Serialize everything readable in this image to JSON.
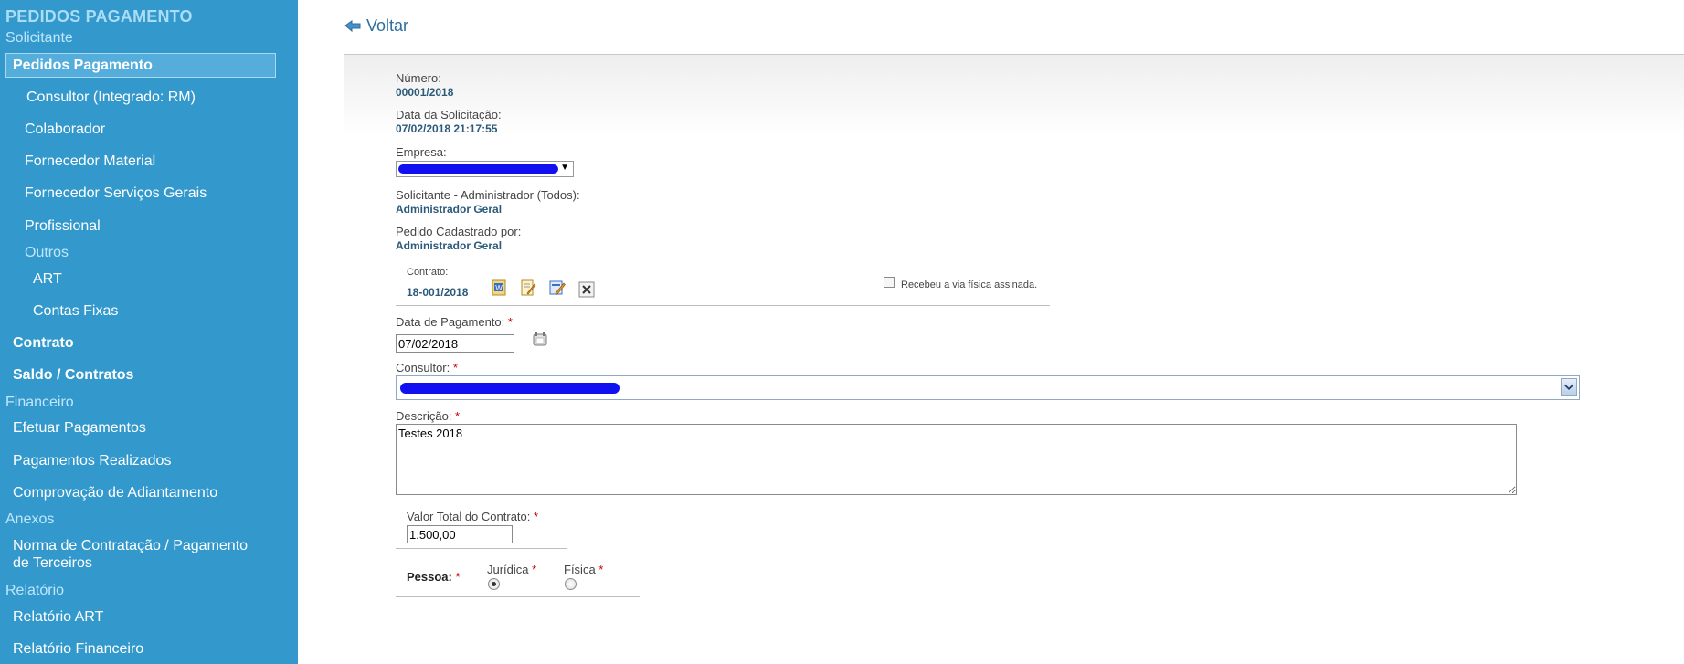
{
  "sidebar": {
    "title": "PEDIDOS PAGAMENTO",
    "sections": {
      "solicitante": "Solicitante",
      "outros": "Outros",
      "financeiro": "Financeiro",
      "anexos": "Anexos",
      "relatorio": "Relatório"
    },
    "items": {
      "pedidos": "Pedidos Pagamento",
      "consultor": "Consultor (Integrado: RM)",
      "colaborador": "Colaborador",
      "fornecedor_material": "Fornecedor Material",
      "fornecedor_servicos": "Fornecedor Serviços Gerais",
      "profissional": "Profissional",
      "art": "ART",
      "contas_fixas": "Contas Fixas",
      "contrato": "Contrato",
      "saldo_contratos": "Saldo / Contratos",
      "efetuar": "Efetuar Pagamentos",
      "realizados": "Pagamentos Realizados",
      "comprovacao": "Comprovação de Adiantamento",
      "norma_line1": "Norma de Contratação / Pagamento",
      "norma_line2": "de Terceiros",
      "rel_art": "Relatório ART",
      "rel_financeiro": "Relatório Financeiro"
    },
    "colors": {
      "background": "#3399cc",
      "section": "#bfe6fb"
    }
  },
  "header": {
    "back_label": "Voltar"
  },
  "form": {
    "numero_label": "Número:",
    "numero_value": "00001/2018",
    "data_solicitacao_label": "Data da Solicitação:",
    "data_solicitacao_value": "07/02/2018 21:17:55",
    "empresa_label": "Empresa:",
    "solicitante_label": "Solicitante - Administrador (Todos):",
    "solicitante_value": "Administrador Geral",
    "cadastrado_label": "Pedido Cadastrado por:",
    "cadastrado_value": "Administrador Geral",
    "contrato_label": "Contrato:",
    "contrato_value": "18-001/2018",
    "via_fisica_label": "Recebeu a via física assinada.",
    "data_pagamento_label": "Data de Pagamento:",
    "data_pagamento_value": "07/02/2018",
    "consultor_label": "Consultor:",
    "descricao_label": "Descrição:",
    "descricao_value": "Testes 2018",
    "valor_total_label": "Valor Total do Contrato:",
    "valor_total_value": "1.500,00",
    "pessoa_label": "Pessoa:",
    "juridica_label": "Jurídica",
    "fisica_label": "Física",
    "required_mark": "*"
  }
}
